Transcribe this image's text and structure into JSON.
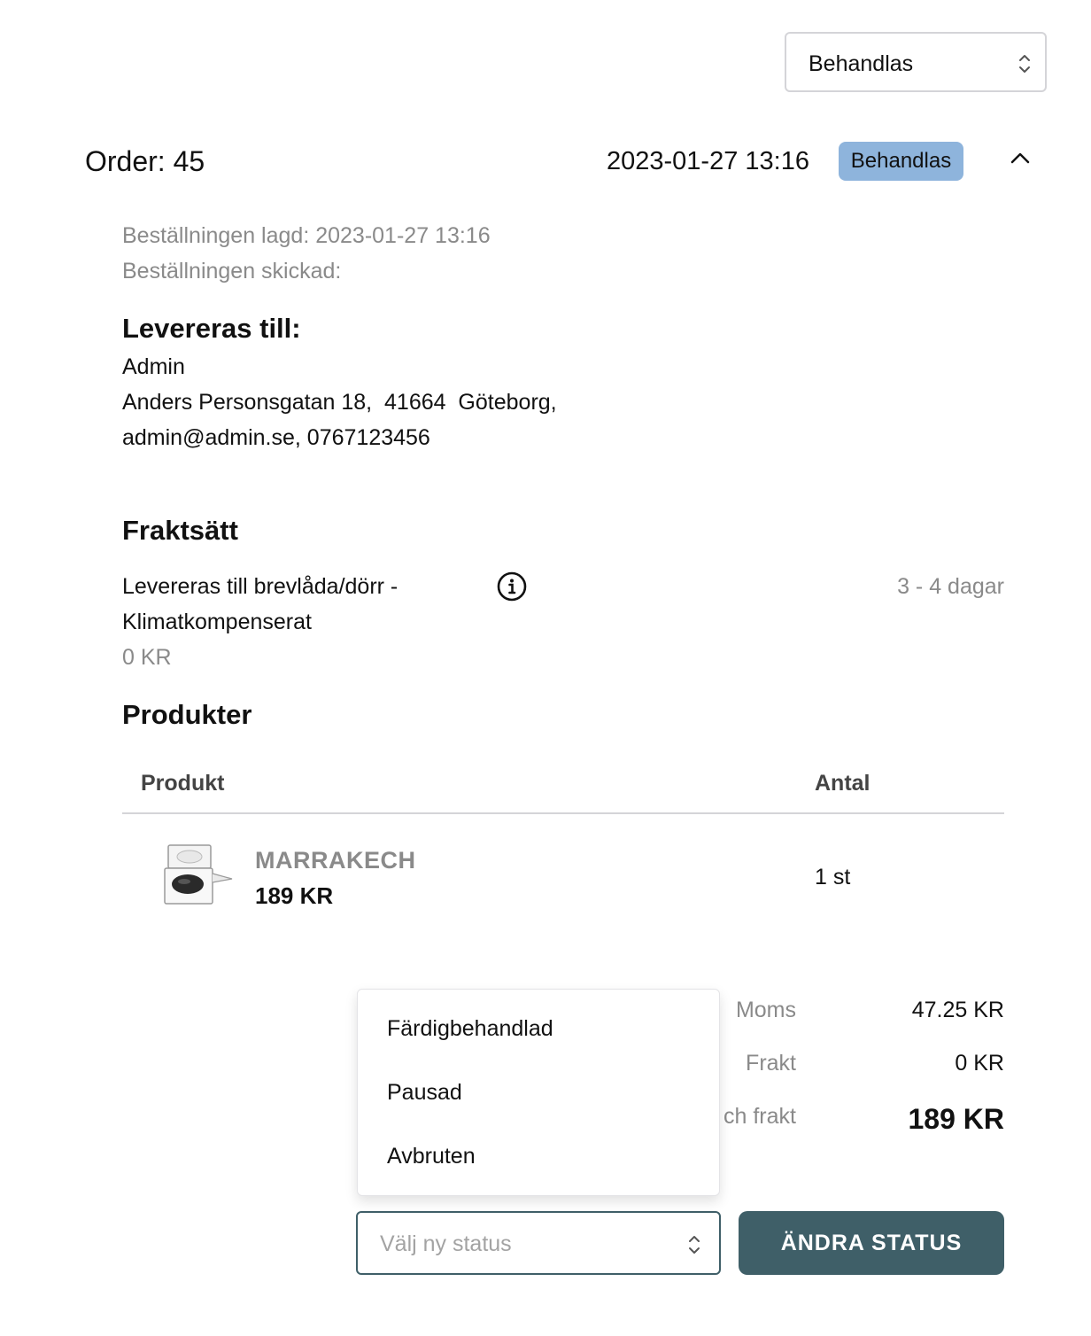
{
  "status_filter": {
    "selected": "Behandlas",
    "icon": "chevron-updown-icon"
  },
  "order": {
    "title": "Order: 45",
    "date": "2023-01-27 13:16",
    "status_badge": "Behandlas",
    "badge_color": "#8eb4dc",
    "collapse_icon": "chevron-up-icon",
    "placed": "Beställningen lagd: 2023-01-27 13:16",
    "shipped": "Beställningen skickad:"
  },
  "delivery": {
    "heading": "Levereras till:",
    "name": "Admin",
    "address": "Anders Personsgatan 18,  41664  Göteborg,",
    "contact": "admin@admin.se, 0767123456"
  },
  "shipping": {
    "heading": "Fraktsätt",
    "method_line1": "Levereras till brevlåda/dörr -",
    "method_line2": "Klimatkompenserat",
    "price": "0 KR",
    "time": "3 - 4 dagar",
    "info_icon": "info-icon"
  },
  "products": {
    "heading": "Produkter",
    "col_product": "Produkt",
    "col_quantity": "Antal",
    "items": [
      {
        "name": "MARRAKECH",
        "price": "189 KR",
        "quantity": "1 st",
        "image": "eyeshadow-compact-image"
      }
    ]
  },
  "summary": {
    "vat_label": "Moms",
    "vat_value": "47.25 KR",
    "shipping_label": "Frakt",
    "shipping_value": "0 KR",
    "total_label_visible": "ch frakt",
    "total_value": "189 KR"
  },
  "status_menu": {
    "options": [
      "Färdigbehandlad",
      "Pausad",
      "Avbruten"
    ]
  },
  "new_status": {
    "placeholder": "Välj ny status",
    "button_label": "ÄNDRA STATUS",
    "button_color": "#3f5f68"
  }
}
